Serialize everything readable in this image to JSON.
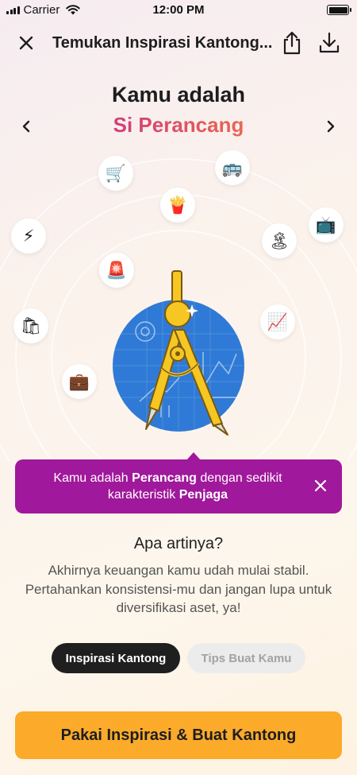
{
  "status_bar": {
    "carrier": "Carrier",
    "time": "12:00 PM"
  },
  "header": {
    "title": "Temukan Inspirasi Kantong..."
  },
  "persona": {
    "heading": "Kamu adalah",
    "name": "Si Perancang"
  },
  "orbit_items": [
    {
      "icon": "shopping-cart-icon",
      "glyph": "🛒"
    },
    {
      "icon": "bus-icon",
      "glyph": "🚌"
    },
    {
      "icon": "fries-icon",
      "glyph": "🍟"
    },
    {
      "icon": "television-icon",
      "glyph": "📺"
    },
    {
      "icon": "lightning-icon",
      "glyph": "⚡"
    },
    {
      "icon": "island-icon",
      "glyph": "🏝"
    },
    {
      "icon": "siren-icon",
      "glyph": "🚨"
    },
    {
      "icon": "shopping-bags-icon",
      "glyph": "🛍"
    },
    {
      "icon": "chart-increasing-icon",
      "glyph": "📈"
    },
    {
      "icon": "briefcase-icon",
      "glyph": "💼"
    }
  ],
  "tooltip": {
    "part1": "Kamu adalah ",
    "bold1": "Perancang",
    "part2": " dengan sedikit karakteristik ",
    "bold2": "Penjaga"
  },
  "meaning": {
    "title": "Apa artinya?",
    "body": "Akhirnya keuangan kamu udah mulai stabil. Pertahankan konsistensi-mu dan jangan lupa untuk diversifikasi aset, ya!"
  },
  "tabs": [
    {
      "label": "Inspirasi Kantong",
      "active": true
    },
    {
      "label": "Tips Buat Kamu",
      "active": false
    }
  ],
  "cta": {
    "label": "Pakai Inspirasi & Buat Kantong"
  },
  "colors": {
    "tooltip_bg": "#a0189b",
    "cta_bg": "#fbaa2a",
    "illustration_circle": "#2f7ad6",
    "compass_yellow": "#f6c623",
    "persona_gradient_start": "#c5308e",
    "persona_gradient_end": "#ef7b4f"
  }
}
